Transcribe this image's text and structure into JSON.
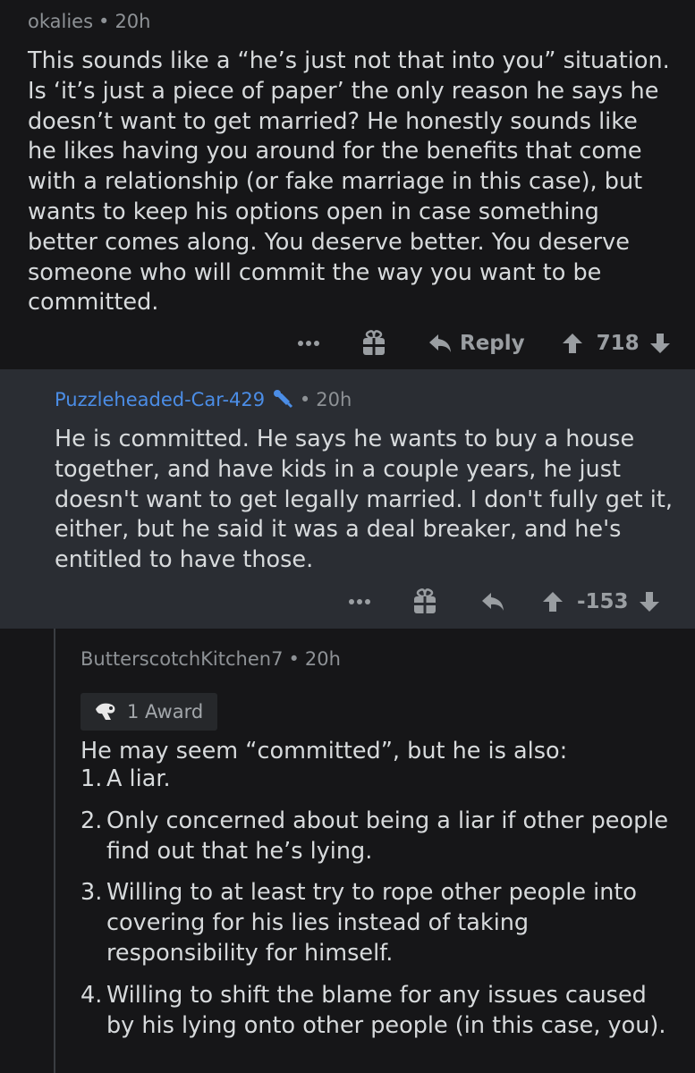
{
  "comments": [
    {
      "username": "okalies",
      "time": "20h",
      "text": [
        "This sounds like a “he’s just not that into you” situation.",
        "Is ‘it’s just a piece of paper’ the only reason he says he",
        "doesn’t want to get married? He honestly sounds like",
        "he likes having you around for the benefits that come",
        "with a relationship (or fake marriage in this case), but",
        "wants to keep his options open in case something",
        "better comes along. You deserve better. You deserve",
        "someone who will commit the way you want to be",
        "committed."
      ],
      "reply_label": "Reply",
      "score": "718"
    },
    {
      "username": "Puzzleheaded-Car-429",
      "time": "20h",
      "text": [
        "He is committed. He says he wants to buy a house",
        "together, and have kids in a couple years, he just",
        "doesn't want to get legally married. I don't fully get it,",
        "either, but he said it was a deal breaker, and he's",
        "entitled to have those."
      ],
      "score": "-153"
    },
    {
      "username": "ButterscotchKitchen7",
      "time": "20h",
      "award_label": "1 Award",
      "intro": "He may seem “committed”, but he is also:",
      "list": [
        {
          "num": "1.",
          "lines": [
            "A liar."
          ]
        },
        {
          "num": "2.",
          "lines": [
            "Only concerned about being a liar if other people",
            "find out that he’s lying."
          ]
        },
        {
          "num": "3.",
          "lines": [
            "Willing to at least try to rope other people into",
            "covering for his lies instead of taking",
            "responsibility for himself."
          ]
        },
        {
          "num": "4.",
          "lines": [
            "Willing to shift the blame for any issues caused",
            "by his lying onto other people (in this case, you)."
          ]
        }
      ]
    }
  ],
  "icons": {
    "more": "more-options-icon",
    "gift": "gift-icon",
    "reply": "reply-arrow-icon",
    "upvote": "upvote-arrow-icon",
    "downvote": "downvote-arrow-icon",
    "op_badge": "op-microphone-icon",
    "award": "award-icon"
  },
  "colors": {
    "background": "#161618",
    "reply_background": "#2a2d33",
    "op_username": "#4b8de6",
    "text": "#d7dadc",
    "muted": "#8e9296"
  }
}
